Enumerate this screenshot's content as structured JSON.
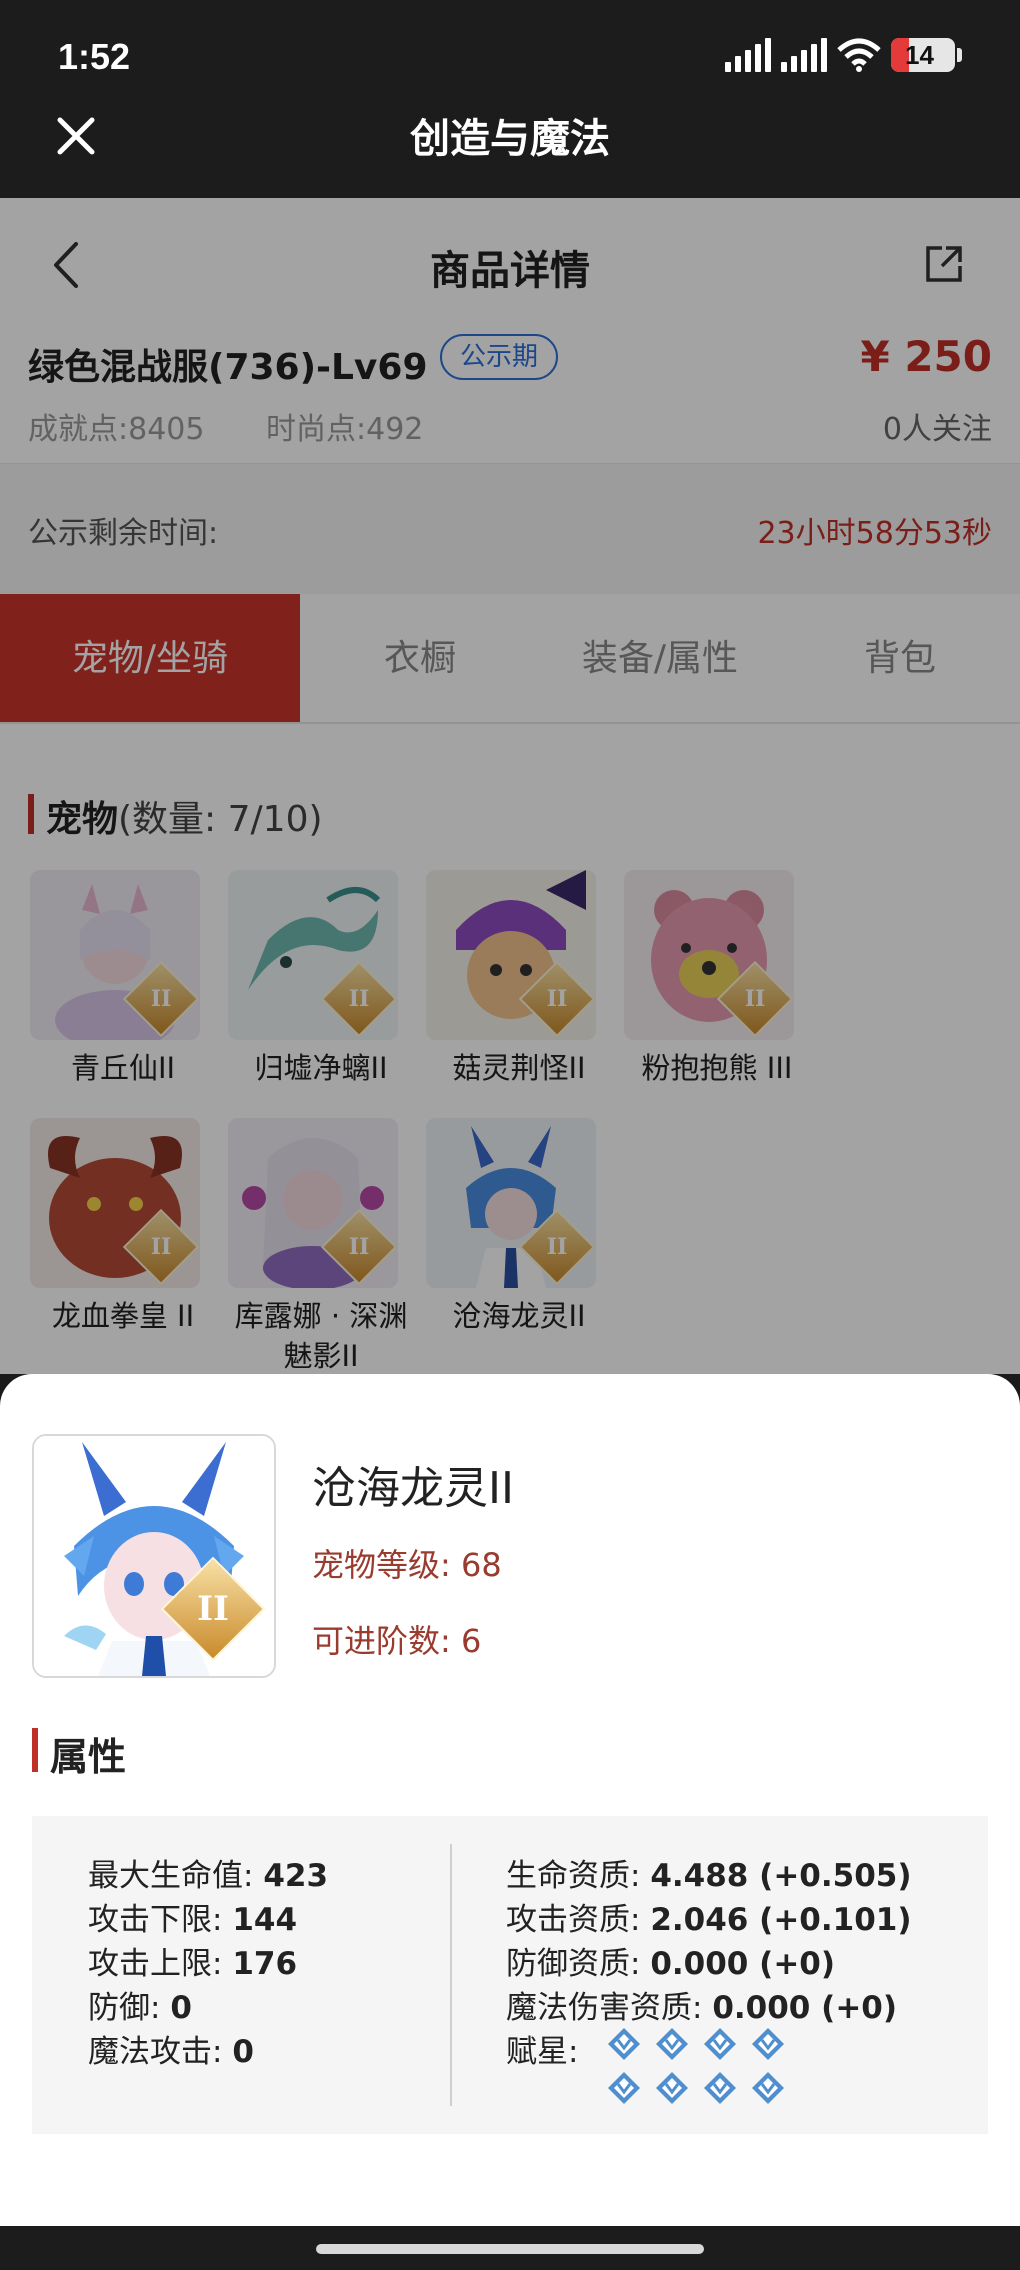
{
  "status_bar": {
    "time": "1:52",
    "battery": "14"
  },
  "app_header": {
    "title": "创造与魔法"
  },
  "nav": {
    "title": "商品详情"
  },
  "product": {
    "name": "绿色混战服(736)-Lv69",
    "badge": "公示期",
    "price": "¥ 250",
    "achievement": "成就点:8405",
    "fashion": "时尚点:492",
    "followers": "0人关注"
  },
  "countdown": {
    "label": "公示剩余时间:",
    "value": "23小时58分53秒"
  },
  "tabs": [
    "宠物/坐骑",
    "衣橱",
    "装备/属性",
    "背包"
  ],
  "pets_section": {
    "title": "宠物",
    "count": "(数量: 7/10)",
    "pets": [
      {
        "name": "青丘仙II"
      },
      {
        "name": "归墟净螭II"
      },
      {
        "name": "菇灵荆怪II"
      },
      {
        "name": "粉抱抱熊 III"
      },
      {
        "name": "龙血拳皇 II"
      },
      {
        "name": "库露娜 · 深渊魅影II"
      },
      {
        "name": "沧海龙灵II"
      }
    ]
  },
  "detail": {
    "name": "沧海龙灵II",
    "level": "宠物等级: 68",
    "advance": "可进阶数: 6",
    "attr_title": "属性",
    "left_attrs": [
      {
        "label": "最大生命值: ",
        "value": "423"
      },
      {
        "label": "攻击下限: ",
        "value": "144"
      },
      {
        "label": "攻击上限: ",
        "value": "176"
      },
      {
        "label": "防御: ",
        "value": "0"
      },
      {
        "label": "魔法攻击: ",
        "value": "0"
      }
    ],
    "right_attrs": [
      {
        "label": "生命资质: ",
        "value": "4.488 (+0.505)"
      },
      {
        "label": "攻击资质: ",
        "value": "2.046 (+0.101)"
      },
      {
        "label": "防御资质: ",
        "value": "0.000 (+0)"
      },
      {
        "label": "魔法伤害资质: ",
        "value": "0.000 (+0)"
      }
    ],
    "star_label": "赋星:",
    "stars": 8
  },
  "colors": {
    "accent": "#c8342c",
    "badge_blue": "#2f6fd8",
    "header_bg": "#1c1c1c"
  }
}
